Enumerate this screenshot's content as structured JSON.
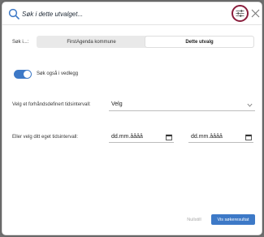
{
  "search": {
    "placeholder": "Søk i dette utvalget..."
  },
  "scope": {
    "label": "Søk i...:",
    "options": [
      "FirstAgenda kommune",
      "Dette utvalg"
    ],
    "selected": "Dette utvalg"
  },
  "attachments": {
    "label": "Søk også i vedlegg",
    "enabled": true
  },
  "predefined": {
    "label": "Velg et forhåndsdefinert tidsintervall:",
    "value": "Velg"
  },
  "custom": {
    "label": "Eller velg ditt eget tidsintervall:",
    "from_placeholder": "dd.mm.åååå",
    "to_placeholder": "dd.mm.åååå"
  },
  "footer": {
    "reset_label": "Nullstill",
    "show_label": "Vis søkeresultat"
  },
  "colors": {
    "accent": "#3d79c7",
    "highlight_ring": "#8a1d3c"
  }
}
